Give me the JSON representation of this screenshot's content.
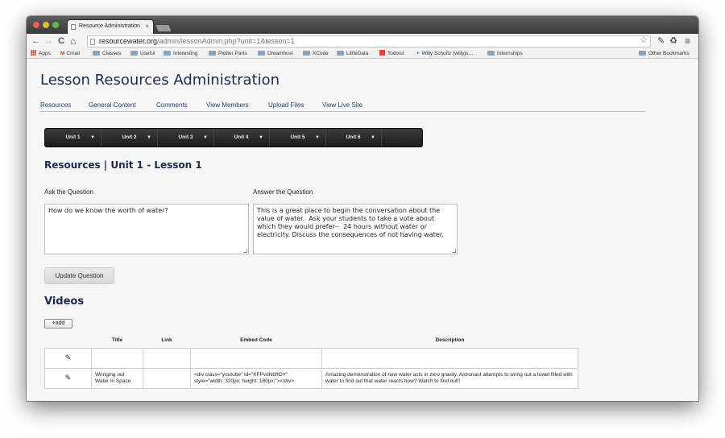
{
  "browser": {
    "tab_title": "Resource Administration",
    "tab_close": "×",
    "url_domain": "resourcewater.org",
    "url_path": "/admin/lessonAdmin.php?unit=1&lesson=1",
    "back_icon": "←",
    "forward_icon": "→",
    "reload_icon": "C",
    "home_icon": "⌂",
    "star_icon": "☆",
    "menu_icon": "≡",
    "bookmarks": [
      {
        "label": "Apps",
        "icon": "apps-grid"
      },
      {
        "label": "Cmail",
        "icon": "gmail"
      },
      {
        "label": "Classes",
        "icon": "folder"
      },
      {
        "label": "Useful",
        "icon": "folder"
      },
      {
        "label": "Interesting",
        "icon": "folder"
      },
      {
        "label": "Plotter Parts",
        "icon": "folder"
      },
      {
        "label": "Dreamhost",
        "icon": "folder"
      },
      {
        "label": "XCode",
        "icon": "folder"
      },
      {
        "label": "LittleData",
        "icon": "folder"
      },
      {
        "label": "Todoist",
        "icon": "todoist"
      },
      {
        "label": "Willy Schultz (willyjs…",
        "icon": "twitter"
      },
      {
        "label": "Internships",
        "icon": "folder"
      }
    ],
    "other_bookmarks": "Other Bookmarks"
  },
  "page": {
    "title": "Lesson Resources Administration",
    "nav": [
      "Resources",
      "General Content",
      "Comments",
      "View Members",
      "Upload Files",
      "View Live Site"
    ],
    "units": [
      "Unit 1",
      "Unit 2",
      "Unit 3",
      "Unit 4",
      "Unit 5",
      "Unit 6"
    ],
    "caret": "▼",
    "section_title": "Resources | Unit 1 - Lesson 1",
    "ask_label": "Ask the Question",
    "ask_value": "How do we know the worth of water?",
    "answer_label": "Answer the Question",
    "answer_value": "This is a great place to begin the conversation about the value of water.  Ask your students to take a vote about which they would prefer--  24 hours without water or electricity. Discuss the consequences of not having water.",
    "update_button": "Update Question",
    "videos_title": "Videos",
    "add_button": "+add",
    "table": {
      "columns": [
        "",
        "Title",
        "Link",
        "Embed Code",
        "Description"
      ],
      "rows": [
        {
          "edit": "✎",
          "title": "",
          "link": "",
          "embed": "",
          "description": ""
        },
        {
          "edit": "✎",
          "title": "Wringing out Water in Space",
          "link": "",
          "embed": "<div class=\"youtube\" id=\"KFPvdNbftOY\" style=\"width: 320px; height: 180px;\"></div>",
          "description": "Amazing demonstration of how water acts in zero gravity. Astronaut attempts to wring out a towel filled with water to find out that water reacts how? Watch to find out!!"
        }
      ]
    }
  }
}
